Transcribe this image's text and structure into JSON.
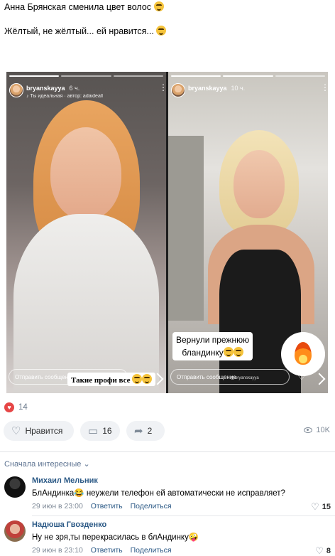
{
  "post": {
    "line1": "Анна Брянская сменила цвет волос",
    "line2": "Жёлтый, не жёлтый... ей нравится..."
  },
  "stories": [
    {
      "username": "bryanskayya",
      "time": "6 ч.",
      "subtitle": "♪ Ты идеальная · автор: adaideall",
      "message_placeholder": "Отправить сообщение",
      "caption": "Такие профи все"
    },
    {
      "username": "bryanskayya",
      "time": "10 ч.",
      "message_placeholder": "Отправить сообщение",
      "caption_line1": "Вернули прежнюю",
      "caption_line2": "бландинку",
      "watermark": "@bryanskayya"
    }
  ],
  "reactions": {
    "count": "14"
  },
  "actions": {
    "like_label": "Нравится",
    "comments_count": "16",
    "shares_count": "2",
    "views": "10K"
  },
  "sort": {
    "label": "Сначала интересные"
  },
  "comments": [
    {
      "author": "Михаил Мельник",
      "text": "БлАндинка😂 неужели телефон ей автоматически не исправляет?",
      "date": "29 июн в 23:00",
      "reply": "Ответить",
      "share": "Поделиться",
      "likes": "15"
    },
    {
      "author": "Надюша Гвозденко",
      "text": "Ну не зря,ты перекрасилась в блАндинку🤪",
      "date": "29 июн в 23:10",
      "reply": "Ответить",
      "share": "Поделиться",
      "likes": "8"
    }
  ],
  "colors": {
    "link": "#2a5885",
    "like_red": "#e64646",
    "button_bg": "#f0f2f5",
    "muted": "#818c99"
  }
}
